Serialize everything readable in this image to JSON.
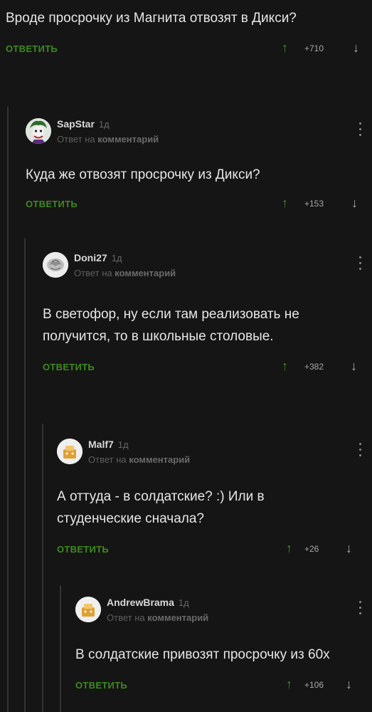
{
  "comments": [
    {
      "text": "Вроде просрочку из Магнита отвозят в Дикси?",
      "reply_label": "ОТВЕТИТЬ",
      "score": "+710"
    },
    {
      "user": "SapStar",
      "age": "1д",
      "meta_prefix": "Ответ на",
      "meta_target": "комментарий",
      "text": "Куда же отвозят просрочку из Дикси?",
      "reply_label": "ОТВЕТИТЬ",
      "score": "+153"
    },
    {
      "user": "Doni27",
      "age": "1д",
      "meta_prefix": "Ответ на",
      "meta_target": "комментарий",
      "text": "В светофор, ну если там реализовать не получится, то в школьные столовые.",
      "reply_label": "ОТВЕТИТЬ",
      "score": "+382"
    },
    {
      "user": "Malf7",
      "age": "1д",
      "meta_prefix": "Ответ на",
      "meta_target": "комментарий",
      "text": "А оттуда - в солдатские? :) Или в студенческие сначала?",
      "reply_label": "ОТВЕТИТЬ",
      "score": "+26"
    },
    {
      "user": "AndrewBrama",
      "age": "1д",
      "meta_prefix": "Ответ на",
      "meta_target": "комментарий",
      "text": "В солдатские привозят просрочку из 60х",
      "reply_label": "ОТВЕТИТЬ",
      "score": "+106"
    }
  ],
  "icons": {
    "upvote": "arrow-up-icon",
    "downvote": "arrow-down-icon",
    "more": "more-vertical-icon"
  },
  "colors": {
    "background": "#151515",
    "reply": "#3e8a1f",
    "upvote": "#4a8a2a"
  }
}
